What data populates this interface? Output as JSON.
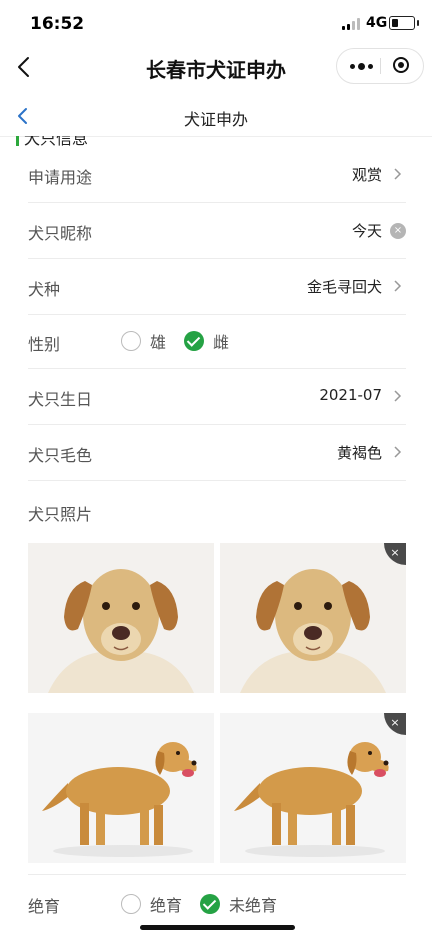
{
  "status": {
    "time": "16:52",
    "network": "4G"
  },
  "nav": {
    "title": "长春市犬证申办"
  },
  "sub_header": {
    "title": "犬证申办"
  },
  "section": {
    "title": "犬只信息"
  },
  "fields": {
    "purpose": {
      "label": "申请用途",
      "value": "观赏"
    },
    "nickname": {
      "label": "犬只昵称",
      "value": "今天"
    },
    "breed": {
      "label": "犬种",
      "value": "金毛寻回犬"
    },
    "gender": {
      "label": "性别",
      "options": [
        "雄",
        "雌"
      ],
      "selected": "雌"
    },
    "birthday": {
      "label": "犬只生日",
      "value": "2021-07"
    },
    "coat": {
      "label": "犬只毛色",
      "value": "黄褐色"
    },
    "photos": {
      "label": "犬只照片"
    },
    "neutered": {
      "label": "绝育",
      "options": [
        "绝育",
        "未绝育"
      ],
      "selected": "未绝育"
    }
  },
  "icons": {
    "remove": "×",
    "clear": "×"
  },
  "colors": {
    "accent_green": "#25a244",
    "section_bar": "#2ca83c"
  }
}
